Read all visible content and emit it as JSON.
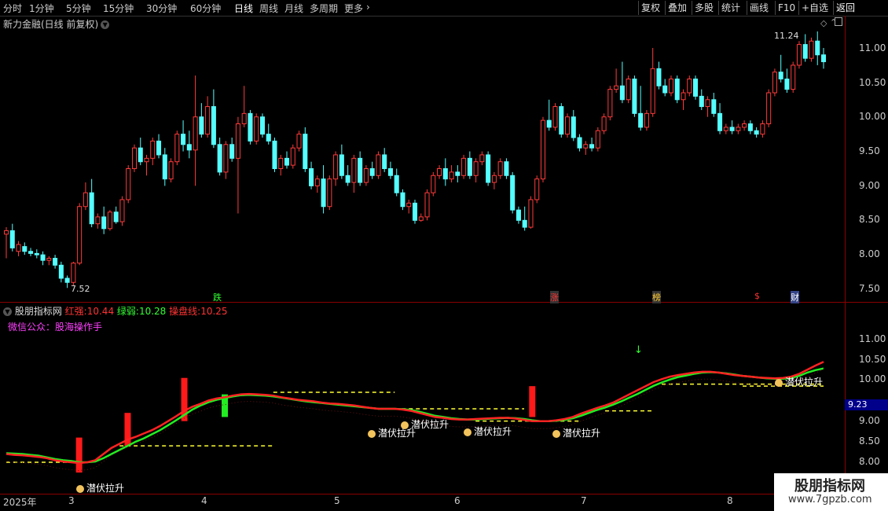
{
  "toolbar": {
    "timeframes": [
      "分时",
      "1分钟",
      "5分钟",
      "15分钟",
      "30分钟",
      "60分钟",
      "日线",
      "周线",
      "月线",
      "多周期",
      "更多"
    ],
    "active_timeframe": "日线",
    "right_buttons": [
      "复权",
      "叠加",
      "多股",
      "统计",
      "画线",
      "F10",
      "+自选",
      "返回"
    ]
  },
  "stock": {
    "title": "新力金融(日线 前复权)"
  },
  "price_axis": [
    "11.00",
    "10.50",
    "10.00",
    "9.50",
    "9.00",
    "8.50",
    "8.00",
    "7.50"
  ],
  "indicator_axis": [
    "11.00",
    "10.50",
    "10.00",
    "9.50",
    "9.00",
    "8.50",
    "8.00"
  ],
  "price_annotations": {
    "high": "11.24",
    "low": "7.52"
  },
  "event_markers": [
    "跌",
    "涨",
    "榜",
    "$",
    "财"
  ],
  "indicator": {
    "name": "股朋指标网",
    "items": [
      {
        "label": "红强:",
        "value": "10.44",
        "color": "#ff3333"
      },
      {
        "label": "绿弱:",
        "value": "10.28",
        "color": "#33ff33"
      },
      {
        "label": "操盘线:",
        "value": "10.25",
        "color": "#ff3333"
      }
    ],
    "subtitle": "微信公众：股海操作手",
    "signal_label": "潜伏拉升",
    "current_price_tag": "9.23"
  },
  "x_axis": [
    "2025年",
    "3",
    "4",
    "5",
    "6",
    "7",
    "8"
  ],
  "watermark": {
    "title": "股朋指标网",
    "url": "www.7gpzb.com"
  },
  "colors": {
    "up": "#ff3b3b",
    "down": "#54ffff",
    "red_line": "#ff2222",
    "green_line": "#22ee22",
    "yellow_dash": "#ffff33"
  },
  "chart_data": {
    "type": "candlestick",
    "ylim": [
      7.4,
      11.3
    ],
    "candles": [
      [
        8.3,
        8.4,
        7.95,
        8.35
      ],
      [
        8.35,
        8.45,
        8.05,
        8.1
      ],
      [
        8.05,
        8.2,
        7.98,
        8.15
      ],
      [
        8.12,
        8.18,
        8.0,
        8.05
      ],
      [
        8.05,
        8.1,
        7.98,
        8.02
      ],
      [
        8.02,
        8.08,
        7.95,
        8.0
      ],
      [
        8.0,
        8.05,
        7.85,
        7.92
      ],
      [
        7.92,
        7.98,
        7.85,
        7.95
      ],
      [
        7.95,
        8.0,
        7.8,
        7.85
      ],
      [
        7.85,
        7.9,
        7.6,
        7.66
      ],
      [
        7.66,
        7.7,
        7.52,
        7.6
      ],
      [
        7.6,
        7.9,
        7.55,
        7.88
      ],
      [
        7.88,
        8.75,
        7.85,
        8.7
      ],
      [
        8.7,
        9.05,
        8.65,
        8.9
      ],
      [
        8.9,
        9.1,
        8.4,
        8.45
      ],
      [
        8.45,
        8.6,
        8.38,
        8.55
      ],
      [
        8.55,
        8.7,
        8.3,
        8.38
      ],
      [
        8.38,
        8.65,
        8.35,
        8.62
      ],
      [
        8.62,
        8.7,
        8.45,
        8.48
      ],
      [
        8.48,
        8.85,
        8.42,
        8.8
      ],
      [
        8.8,
        9.3,
        8.75,
        9.25
      ],
      [
        9.25,
        9.6,
        9.2,
        9.55
      ],
      [
        9.55,
        9.7,
        9.3,
        9.35
      ],
      [
        9.35,
        9.45,
        9.15,
        9.4
      ],
      [
        9.4,
        9.7,
        9.3,
        9.65
      ],
      [
        9.65,
        9.75,
        9.4,
        9.45
      ],
      [
        9.45,
        9.55,
        9.0,
        9.1
      ],
      [
        9.1,
        9.4,
        9.05,
        9.35
      ],
      [
        9.35,
        9.8,
        9.3,
        9.75
      ],
      [
        9.75,
        9.95,
        9.5,
        9.6
      ],
      [
        9.6,
        9.8,
        9.4,
        9.52
      ],
      [
        9.52,
        10.6,
        9.0,
        10.0
      ],
      [
        10.0,
        10.2,
        9.7,
        9.75
      ],
      [
        9.75,
        10.3,
        9.7,
        10.15
      ],
      [
        10.15,
        10.4,
        9.55,
        9.6
      ],
      [
        9.6,
        9.7,
        9.15,
        9.2
      ],
      [
        9.2,
        9.65,
        9.1,
        9.6
      ],
      [
        9.6,
        9.7,
        9.35,
        9.4
      ],
      [
        9.4,
        10.0,
        8.6,
        9.9
      ],
      [
        9.9,
        10.45,
        9.85,
        10.05
      ],
      [
        10.05,
        10.1,
        9.6,
        9.65
      ],
      [
        9.65,
        10.05,
        9.6,
        10.0
      ],
      [
        10.0,
        10.05,
        9.7,
        9.75
      ],
      [
        9.75,
        9.9,
        9.6,
        9.65
      ],
      [
        9.65,
        9.7,
        9.2,
        9.25
      ],
      [
        9.25,
        9.45,
        9.15,
        9.4
      ],
      [
        9.4,
        9.5,
        9.25,
        9.3
      ],
      [
        9.3,
        9.6,
        9.25,
        9.55
      ],
      [
        9.55,
        9.8,
        9.5,
        9.75
      ],
      [
        9.75,
        9.85,
        9.2,
        9.25
      ],
      [
        9.25,
        9.35,
        8.95,
        9.0
      ],
      [
        9.0,
        9.15,
        8.9,
        9.1
      ],
      [
        9.1,
        9.3,
        8.6,
        8.7
      ],
      [
        8.7,
        9.15,
        8.65,
        9.1
      ],
      [
        9.1,
        9.5,
        9.0,
        9.45
      ],
      [
        9.45,
        9.6,
        9.1,
        9.15
      ],
      [
        9.15,
        9.3,
        9.0,
        9.05
      ],
      [
        9.05,
        9.45,
        8.9,
        9.4
      ],
      [
        9.4,
        9.5,
        9.0,
        9.05
      ],
      [
        9.05,
        9.3,
        9.0,
        9.25
      ],
      [
        9.25,
        9.35,
        9.1,
        9.15
      ],
      [
        9.15,
        9.5,
        9.1,
        9.45
      ],
      [
        9.45,
        9.55,
        9.2,
        9.25
      ],
      [
        9.25,
        9.35,
        9.1,
        9.15
      ],
      [
        9.15,
        9.25,
        8.85,
        8.9
      ],
      [
        8.9,
        8.95,
        8.65,
        8.7
      ],
      [
        8.7,
        8.8,
        8.6,
        8.75
      ],
      [
        8.75,
        8.8,
        8.45,
        8.5
      ],
      [
        8.5,
        8.6,
        8.48,
        8.55
      ],
      [
        8.55,
        8.95,
        8.5,
        8.9
      ],
      [
        8.9,
        9.2,
        8.85,
        9.15
      ],
      [
        9.15,
        9.3,
        9.1,
        9.25
      ],
      [
        9.25,
        9.4,
        9.0,
        9.1
      ],
      [
        9.1,
        9.3,
        9.05,
        9.2
      ],
      [
        9.2,
        9.3,
        9.05,
        9.15
      ],
      [
        9.15,
        9.45,
        9.1,
        9.4
      ],
      [
        9.4,
        9.5,
        9.1,
        9.15
      ],
      [
        9.15,
        9.4,
        9.05,
        9.35
      ],
      [
        9.35,
        9.5,
        9.3,
        9.45
      ],
      [
        9.45,
        9.5,
        9.0,
        9.05
      ],
      [
        9.05,
        9.2,
        8.95,
        9.15
      ],
      [
        9.15,
        9.4,
        9.1,
        9.35
      ],
      [
        9.35,
        9.4,
        9.1,
        9.15
      ],
      [
        9.15,
        9.2,
        8.6,
        8.65
      ],
      [
        8.65,
        8.7,
        8.45,
        8.5
      ],
      [
        8.5,
        8.7,
        8.35,
        8.4
      ],
      [
        8.4,
        8.85,
        8.38,
        8.8
      ],
      [
        8.8,
        9.15,
        8.75,
        9.1
      ],
      [
        9.1,
        10.0,
        9.05,
        9.95
      ],
      [
        9.95,
        10.25,
        9.8,
        9.85
      ],
      [
        9.85,
        10.2,
        9.8,
        10.15
      ],
      [
        10.15,
        10.2,
        9.7,
        9.75
      ],
      [
        9.75,
        10.05,
        9.7,
        10.0
      ],
      [
        10.0,
        10.1,
        9.65,
        9.7
      ],
      [
        9.7,
        9.75,
        9.5,
        9.55
      ],
      [
        9.55,
        9.65,
        9.45,
        9.6
      ],
      [
        9.6,
        9.7,
        9.5,
        9.55
      ],
      [
        9.55,
        9.85,
        9.5,
        9.8
      ],
      [
        9.8,
        10.05,
        9.75,
        10.0
      ],
      [
        10.0,
        10.45,
        9.95,
        10.4
      ],
      [
        10.4,
        10.7,
        10.35,
        10.45
      ],
      [
        10.45,
        10.8,
        10.2,
        10.25
      ],
      [
        10.25,
        10.6,
        10.2,
        10.55
      ],
      [
        10.55,
        10.6,
        10.0,
        10.05
      ],
      [
        10.05,
        10.45,
        9.8,
        9.85
      ],
      [
        9.85,
        10.1,
        9.8,
        10.05
      ],
      [
        10.05,
        11.0,
        10.0,
        10.7
      ],
      [
        10.7,
        10.8,
        10.4,
        10.45
      ],
      [
        10.45,
        10.55,
        10.3,
        10.35
      ],
      [
        10.35,
        10.6,
        10.3,
        10.55
      ],
      [
        10.55,
        10.6,
        10.2,
        10.25
      ],
      [
        10.25,
        10.4,
        10.1,
        10.35
      ],
      [
        10.35,
        10.6,
        10.3,
        10.55
      ],
      [
        10.55,
        10.6,
        10.25,
        10.3
      ],
      [
        10.3,
        10.4,
        10.1,
        10.15
      ],
      [
        10.15,
        10.3,
        10.0,
        10.25
      ],
      [
        10.25,
        10.35,
        10.0,
        10.05
      ],
      [
        10.05,
        10.2,
        9.75,
        9.8
      ],
      [
        9.8,
        9.9,
        9.75,
        9.85
      ],
      [
        9.85,
        9.95,
        9.75,
        9.8
      ],
      [
        9.8,
        9.9,
        9.75,
        9.85
      ],
      [
        9.85,
        9.95,
        9.8,
        9.9
      ],
      [
        9.9,
        9.95,
        9.75,
        9.8
      ],
      [
        9.8,
        9.85,
        9.7,
        9.75
      ],
      [
        9.75,
        9.95,
        9.7,
        9.9
      ],
      [
        9.9,
        10.4,
        9.85,
        10.35
      ],
      [
        10.35,
        10.7,
        10.3,
        10.65
      ],
      [
        10.65,
        10.9,
        10.5,
        10.55
      ],
      [
        10.55,
        10.7,
        10.35,
        10.4
      ],
      [
        10.4,
        10.8,
        10.35,
        10.75
      ],
      [
        10.75,
        11.1,
        10.7,
        11.05
      ],
      [
        11.05,
        11.2,
        10.8,
        10.85
      ],
      [
        10.85,
        11.15,
        10.8,
        11.1
      ],
      [
        11.1,
        11.24,
        10.75,
        10.9
      ],
      [
        10.9,
        11.0,
        10.7,
        10.8
      ]
    ],
    "red_strong": [
      8.2,
      8.18,
      8.17,
      8.15,
      8.13,
      8.1,
      8.05,
      8.02,
      8.0,
      7.98,
      8.0,
      8.05,
      8.2,
      8.35,
      8.45,
      8.55,
      8.62,
      8.7,
      8.78,
      8.88,
      9.0,
      9.12,
      9.25,
      9.35,
      9.42,
      9.5,
      9.55,
      9.58,
      9.62,
      9.65,
      9.66,
      9.65,
      9.64,
      9.62,
      9.58,
      9.55,
      9.52,
      9.5,
      9.48,
      9.45,
      9.43,
      9.42,
      9.4,
      9.38,
      9.35,
      9.32,
      9.3,
      9.3,
      9.3,
      9.28,
      9.25,
      9.2,
      9.15,
      9.1,
      9.08,
      9.05,
      9.04,
      9.04,
      9.05,
      9.06,
      9.07,
      9.08,
      9.08,
      9.06,
      9.03,
      9.0,
      9.0,
      9.0,
      9.02,
      9.05,
      9.1,
      9.18,
      9.25,
      9.32,
      9.38,
      9.45,
      9.55,
      9.65,
      9.75,
      9.85,
      9.95,
      10.02,
      10.08,
      10.12,
      10.15,
      10.18,
      10.2,
      10.2,
      10.18,
      10.15,
      10.12,
      10.1,
      10.08,
      10.06,
      10.05,
      10.04,
      10.05,
      10.08,
      10.15,
      10.25,
      10.35,
      10.44
    ],
    "green_weak": [
      8.22,
      8.21,
      8.2,
      8.18,
      8.16,
      8.12,
      8.08,
      8.05,
      8.03,
      8.0,
      8.0,
      8.02,
      8.1,
      8.2,
      8.3,
      8.4,
      8.5,
      8.58,
      8.68,
      8.78,
      8.9,
      9.02,
      9.15,
      9.28,
      9.38,
      9.46,
      9.52,
      9.56,
      9.6,
      9.63,
      9.64,
      9.63,
      9.62,
      9.6,
      9.57,
      9.54,
      9.51,
      9.48,
      9.46,
      9.44,
      9.42,
      9.4,
      9.38,
      9.36,
      9.34,
      9.32,
      9.3,
      9.3,
      9.3,
      9.29,
      9.27,
      9.23,
      9.18,
      9.13,
      9.1,
      9.07,
      9.05,
      9.04,
      9.04,
      9.05,
      9.06,
      9.07,
      9.08,
      9.07,
      9.05,
      9.02,
      9.0,
      9.0,
      9.01,
      9.03,
      9.07,
      9.13,
      9.2,
      9.27,
      9.33,
      9.4,
      9.48,
      9.57,
      9.66,
      9.76,
      9.86,
      9.94,
      10.01,
      10.07,
      10.11,
      10.15,
      10.18,
      10.19,
      10.18,
      10.16,
      10.13,
      10.1,
      10.08,
      10.06,
      10.04,
      10.03,
      10.03,
      10.05,
      10.1,
      10.18,
      10.24,
      10.28
    ],
    "yellow_levels": [
      {
        "from": 0,
        "to": 10,
        "y": 8.0
      },
      {
        "from": 14,
        "to": 33,
        "y": 8.4
      },
      {
        "from": 33,
        "to": 48,
        "y": 9.7
      },
      {
        "from": 48,
        "to": 64,
        "y": 9.3
      },
      {
        "from": 58,
        "to": 71,
        "y": 9.0
      },
      {
        "from": 74,
        "to": 80,
        "y": 9.25
      },
      {
        "from": 81,
        "to": 101,
        "y": 9.9
      },
      {
        "from": 91,
        "to": 101,
        "y": 9.85
      }
    ],
    "red_bars": [
      {
        "i": 9,
        "low": 7.75,
        "high": 8.6
      },
      {
        "i": 15,
        "low": 8.4,
        "high": 9.2
      },
      {
        "i": 22,
        "low": 9.0,
        "high": 10.05
      },
      {
        "i": 65,
        "low": 9.1,
        "high": 9.85
      }
    ],
    "green_bars": [
      {
        "i": 27,
        "low": 9.1,
        "high": 9.65
      }
    ]
  }
}
